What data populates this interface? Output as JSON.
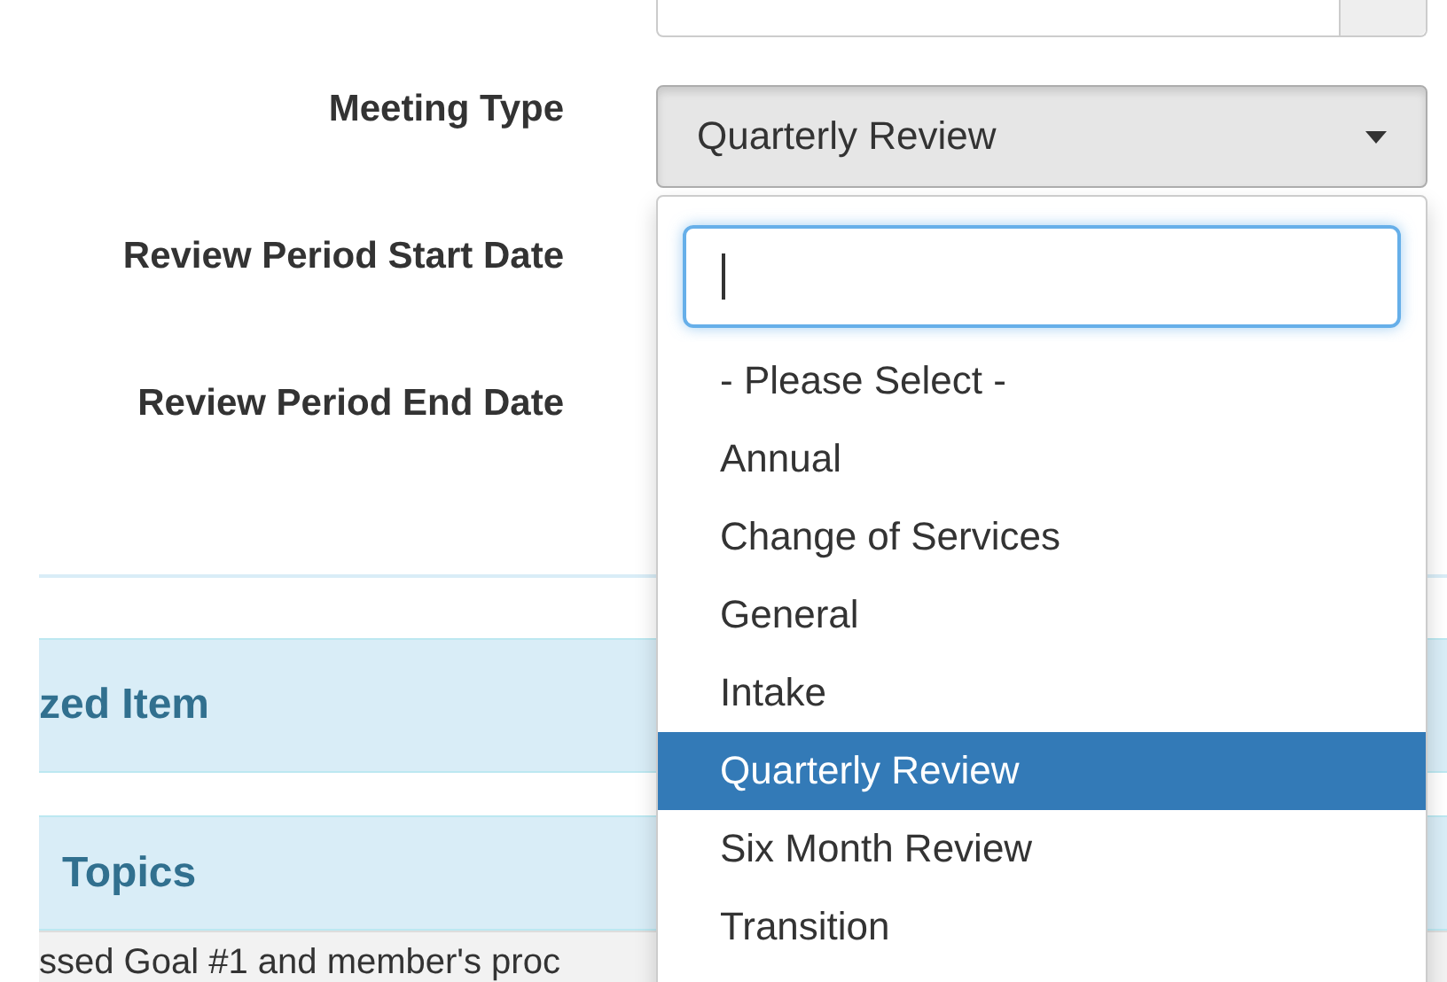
{
  "form": {
    "fields": [
      {
        "label": "Meeting Type",
        "kind": "select",
        "value": "Quarterly Review",
        "open": true
      },
      {
        "label": "Review Period Start Date",
        "kind": "date"
      },
      {
        "label": "Review Period End Date",
        "kind": "date"
      }
    ]
  },
  "dropdown": {
    "options": [
      {
        "label": "- Please Select -",
        "selected": false
      },
      {
        "label": "Annual",
        "selected": false
      },
      {
        "label": "Change of Services",
        "selected": false
      },
      {
        "label": "General",
        "selected": false
      },
      {
        "label": "Intake",
        "selected": false
      },
      {
        "label": "Quarterly Review",
        "selected": true
      },
      {
        "label": "Six Month Review",
        "selected": false
      },
      {
        "label": "Transition",
        "selected": false
      }
    ]
  },
  "panels": [
    {
      "title": "zed Item"
    },
    {
      "title": "Topics"
    }
  ],
  "row_text": "ssed Goal #1 and member's proc"
}
